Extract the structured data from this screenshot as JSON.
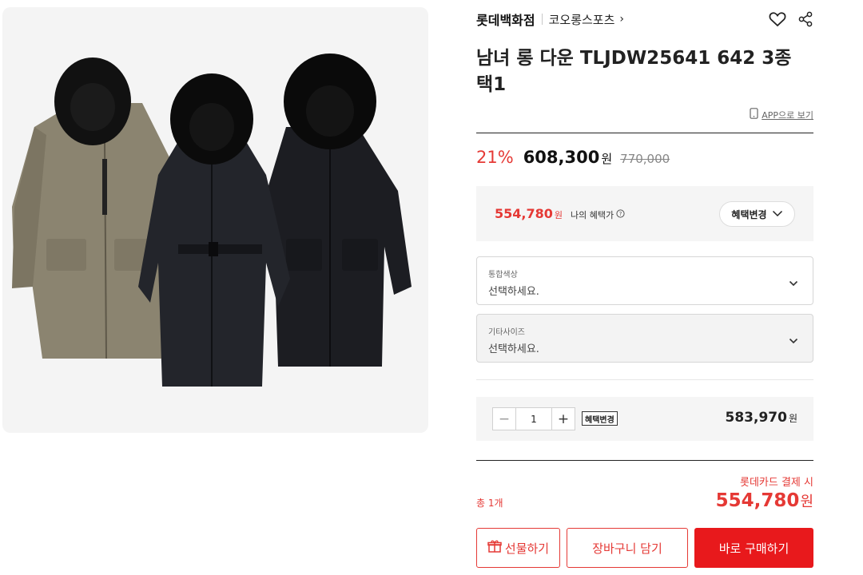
{
  "product": {
    "image_alt": "",
    "store": "롯데백화점",
    "brand": "코오롱스포츠",
    "title": "남녀 롱 다운 TLJDW25641 642 3종 택1",
    "app_link": "APP으로 보기"
  },
  "price": {
    "discount": "21%",
    "sale": "608,300",
    "won": "원",
    "original": "770,000"
  },
  "benefit": {
    "price": "554,780",
    "won": "원",
    "label": "나의 혜택가",
    "change_label": "혜택변경"
  },
  "options": [
    {
      "label": "통합색상",
      "value": "선택하세요."
    },
    {
      "label": "기타사이즈",
      "value": "선택하세요."
    }
  ],
  "quantity": {
    "minus": "−",
    "value": "1",
    "plus": "+",
    "benefit_button": "혜택변경",
    "price": "583,970",
    "won": "원"
  },
  "total": {
    "card_note": "롯데카드 결제 시",
    "count": "총 1개",
    "price": "554,780",
    "won": "원"
  },
  "actions": {
    "gift": "선물하기",
    "cart": "장바구니 담기",
    "buy": "바로 구매하기"
  },
  "colors": {
    "accent": "#e53935",
    "buy_button": "#e8191c",
    "panel_bg": "#f5f5f5"
  },
  "icons": [
    "heart-icon",
    "share-icon",
    "mobile-icon",
    "info-icon",
    "chevron-down-icon",
    "gift-icon"
  ]
}
